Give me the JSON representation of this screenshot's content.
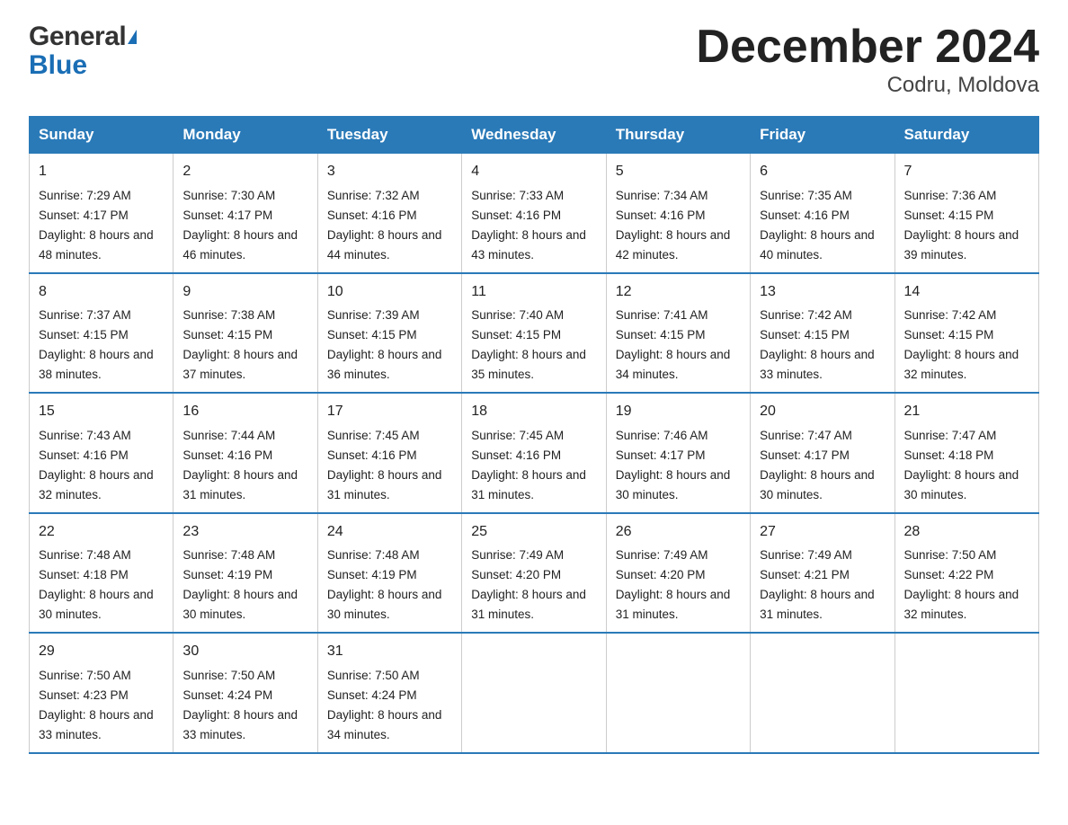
{
  "logo": {
    "general": "General",
    "blue": "Blue"
  },
  "title": "December 2024",
  "subtitle": "Codru, Moldova",
  "days_of_week": [
    "Sunday",
    "Monday",
    "Tuesday",
    "Wednesday",
    "Thursday",
    "Friday",
    "Saturday"
  ],
  "weeks": [
    [
      {
        "day": "1",
        "sunrise": "7:29 AM",
        "sunset": "4:17 PM",
        "daylight": "8 hours and 48 minutes."
      },
      {
        "day": "2",
        "sunrise": "7:30 AM",
        "sunset": "4:17 PM",
        "daylight": "8 hours and 46 minutes."
      },
      {
        "day": "3",
        "sunrise": "7:32 AM",
        "sunset": "4:16 PM",
        "daylight": "8 hours and 44 minutes."
      },
      {
        "day": "4",
        "sunrise": "7:33 AM",
        "sunset": "4:16 PM",
        "daylight": "8 hours and 43 minutes."
      },
      {
        "day": "5",
        "sunrise": "7:34 AM",
        "sunset": "4:16 PM",
        "daylight": "8 hours and 42 minutes."
      },
      {
        "day": "6",
        "sunrise": "7:35 AM",
        "sunset": "4:16 PM",
        "daylight": "8 hours and 40 minutes."
      },
      {
        "day": "7",
        "sunrise": "7:36 AM",
        "sunset": "4:15 PM",
        "daylight": "8 hours and 39 minutes."
      }
    ],
    [
      {
        "day": "8",
        "sunrise": "7:37 AM",
        "sunset": "4:15 PM",
        "daylight": "8 hours and 38 minutes."
      },
      {
        "day": "9",
        "sunrise": "7:38 AM",
        "sunset": "4:15 PM",
        "daylight": "8 hours and 37 minutes."
      },
      {
        "day": "10",
        "sunrise": "7:39 AM",
        "sunset": "4:15 PM",
        "daylight": "8 hours and 36 minutes."
      },
      {
        "day": "11",
        "sunrise": "7:40 AM",
        "sunset": "4:15 PM",
        "daylight": "8 hours and 35 minutes."
      },
      {
        "day": "12",
        "sunrise": "7:41 AM",
        "sunset": "4:15 PM",
        "daylight": "8 hours and 34 minutes."
      },
      {
        "day": "13",
        "sunrise": "7:42 AM",
        "sunset": "4:15 PM",
        "daylight": "8 hours and 33 minutes."
      },
      {
        "day": "14",
        "sunrise": "7:42 AM",
        "sunset": "4:15 PM",
        "daylight": "8 hours and 32 minutes."
      }
    ],
    [
      {
        "day": "15",
        "sunrise": "7:43 AM",
        "sunset": "4:16 PM",
        "daylight": "8 hours and 32 minutes."
      },
      {
        "day": "16",
        "sunrise": "7:44 AM",
        "sunset": "4:16 PM",
        "daylight": "8 hours and 31 minutes."
      },
      {
        "day": "17",
        "sunrise": "7:45 AM",
        "sunset": "4:16 PM",
        "daylight": "8 hours and 31 minutes."
      },
      {
        "day": "18",
        "sunrise": "7:45 AM",
        "sunset": "4:16 PM",
        "daylight": "8 hours and 31 minutes."
      },
      {
        "day": "19",
        "sunrise": "7:46 AM",
        "sunset": "4:17 PM",
        "daylight": "8 hours and 30 minutes."
      },
      {
        "day": "20",
        "sunrise": "7:47 AM",
        "sunset": "4:17 PM",
        "daylight": "8 hours and 30 minutes."
      },
      {
        "day": "21",
        "sunrise": "7:47 AM",
        "sunset": "4:18 PM",
        "daylight": "8 hours and 30 minutes."
      }
    ],
    [
      {
        "day": "22",
        "sunrise": "7:48 AM",
        "sunset": "4:18 PM",
        "daylight": "8 hours and 30 minutes."
      },
      {
        "day": "23",
        "sunrise": "7:48 AM",
        "sunset": "4:19 PM",
        "daylight": "8 hours and 30 minutes."
      },
      {
        "day": "24",
        "sunrise": "7:48 AM",
        "sunset": "4:19 PM",
        "daylight": "8 hours and 30 minutes."
      },
      {
        "day": "25",
        "sunrise": "7:49 AM",
        "sunset": "4:20 PM",
        "daylight": "8 hours and 31 minutes."
      },
      {
        "day": "26",
        "sunrise": "7:49 AM",
        "sunset": "4:20 PM",
        "daylight": "8 hours and 31 minutes."
      },
      {
        "day": "27",
        "sunrise": "7:49 AM",
        "sunset": "4:21 PM",
        "daylight": "8 hours and 31 minutes."
      },
      {
        "day": "28",
        "sunrise": "7:50 AM",
        "sunset": "4:22 PM",
        "daylight": "8 hours and 32 minutes."
      }
    ],
    [
      {
        "day": "29",
        "sunrise": "7:50 AM",
        "sunset": "4:23 PM",
        "daylight": "8 hours and 33 minutes."
      },
      {
        "day": "30",
        "sunrise": "7:50 AM",
        "sunset": "4:24 PM",
        "daylight": "8 hours and 33 minutes."
      },
      {
        "day": "31",
        "sunrise": "7:50 AM",
        "sunset": "4:24 PM",
        "daylight": "8 hours and 34 minutes."
      },
      null,
      null,
      null,
      null
    ]
  ],
  "labels": {
    "sunrise": "Sunrise:",
    "sunset": "Sunset:",
    "daylight": "Daylight:"
  }
}
